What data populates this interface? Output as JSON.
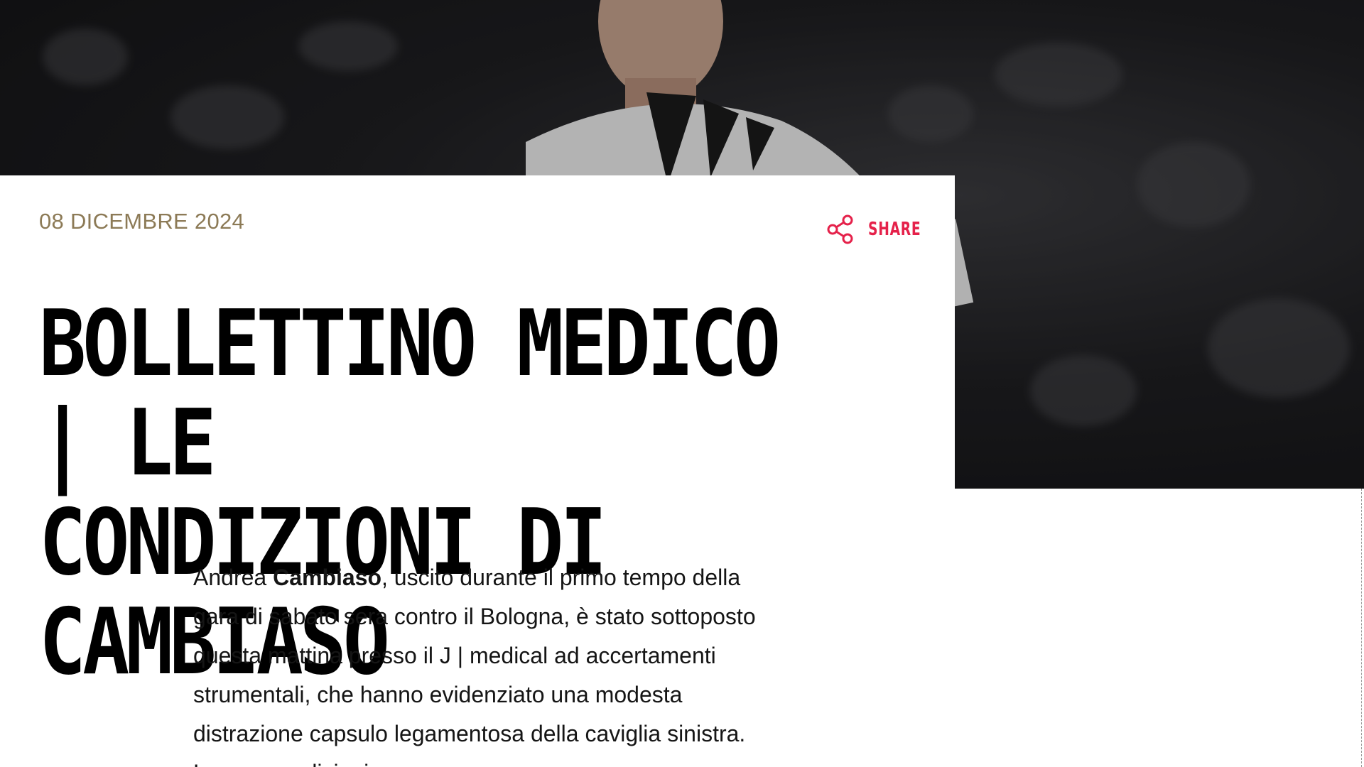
{
  "article": {
    "date": "08 DICEMBRE 2024",
    "share_label": "SHARE",
    "title_line1": "BOLLETTINO MEDICO | LE",
    "title_line2": "CONDIZIONI DI CAMBIASO",
    "body_intro": "Andrea ",
    "body_bold": "Cambiaso",
    "body_rest": ", uscito durante il primo tempo della gara di sabato sera contro il Bologna, è stato sottoposto questa mattina presso il J | medical ad accertamenti strumentali, che hanno evidenziato una modesta distrazione capsulo legamentosa della caviglia sinistra. Le sue condizioni verranno"
  },
  "colors": {
    "accent": "#e5214a",
    "date": "#8c7a56",
    "title": "#000000"
  },
  "icons": {
    "share": "share-icon"
  }
}
